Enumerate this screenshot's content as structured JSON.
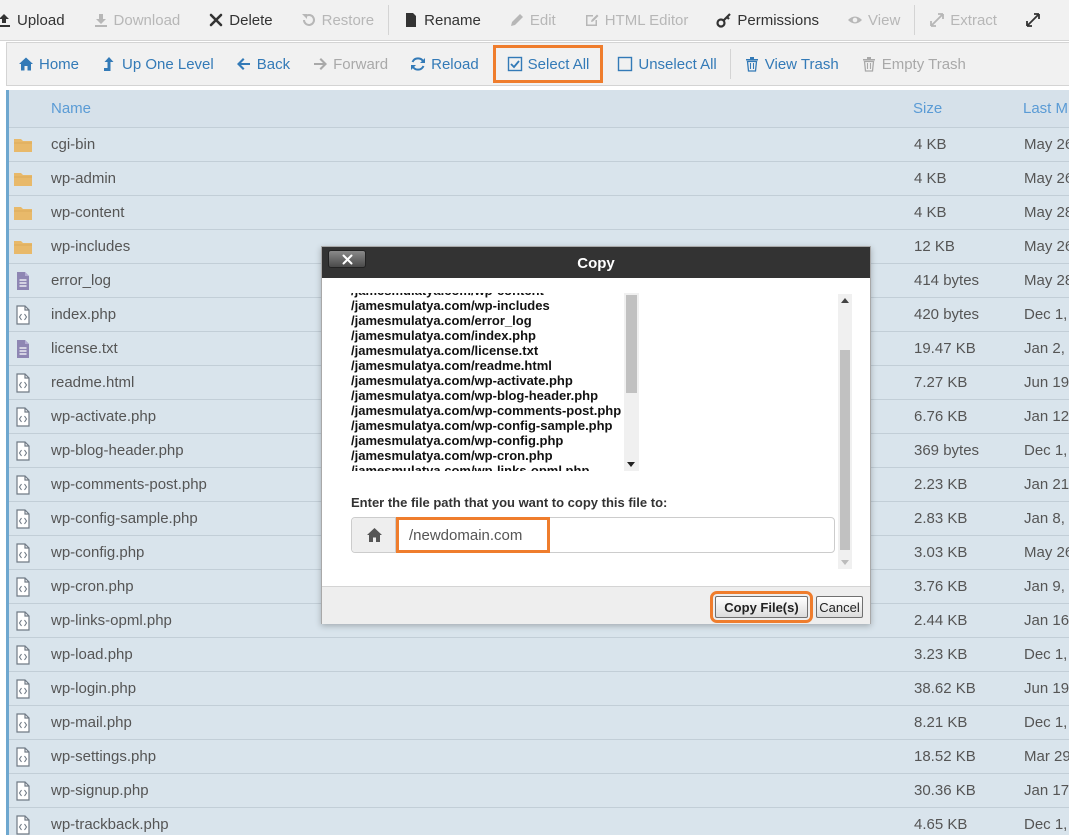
{
  "toolbar_top": [
    {
      "label": "Upload",
      "icon": "upload-icon",
      "disabled": false
    },
    {
      "label": "Download",
      "icon": "download-icon",
      "disabled": true
    },
    {
      "label": "Delete",
      "icon": "close-icon",
      "disabled": false
    },
    {
      "label": "Restore",
      "icon": "restore-icon",
      "disabled": true
    },
    {
      "label": "Rename",
      "icon": "file-icon",
      "disabled": false
    },
    {
      "label": "Edit",
      "icon": "pencil-icon",
      "disabled": true
    },
    {
      "label": "HTML Editor",
      "icon": "edit-square-icon",
      "disabled": true
    },
    {
      "label": "Permissions",
      "icon": "key-icon",
      "disabled": false
    },
    {
      "label": "View",
      "icon": "eye-icon",
      "disabled": true
    },
    {
      "label": "Extract",
      "icon": "expand-icon",
      "disabled": true
    }
  ],
  "toolbar_nav": [
    {
      "label": "Home",
      "icon": "home-icon",
      "disabled": false
    },
    {
      "label": "Up One Level",
      "icon": "level-up-icon",
      "disabled": false
    },
    {
      "label": "Back",
      "icon": "arrow-left-icon",
      "disabled": false
    },
    {
      "label": "Forward",
      "icon": "arrow-right-icon",
      "disabled": true
    },
    {
      "label": "Reload",
      "icon": "refresh-icon",
      "disabled": false
    },
    {
      "label": "Select All",
      "icon": "checkbox-checked-icon",
      "disabled": false,
      "highlighted": true
    },
    {
      "label": "Unselect All",
      "icon": "checkbox-empty-icon",
      "disabled": false
    },
    {
      "label": "View Trash",
      "icon": "trash-icon",
      "disabled": false
    },
    {
      "label": "Empty Trash",
      "icon": "trash-icon",
      "disabled": true
    }
  ],
  "table": {
    "columns": [
      "Name",
      "Size",
      "Last M"
    ],
    "rows": [
      {
        "name": "cgi-bin",
        "type": "folder",
        "size": "4 KB",
        "modified": "May 26"
      },
      {
        "name": "wp-admin",
        "type": "folder",
        "size": "4 KB",
        "modified": "May 26"
      },
      {
        "name": "wp-content",
        "type": "folder",
        "size": "4 KB",
        "modified": "May 28"
      },
      {
        "name": "wp-includes",
        "type": "folder",
        "size": "12 KB",
        "modified": "May 26"
      },
      {
        "name": "error_log",
        "type": "text",
        "size": "414 bytes",
        "modified": "May 28"
      },
      {
        "name": "index.php",
        "type": "code",
        "size": "420 bytes",
        "modified": "Dec 1,"
      },
      {
        "name": "license.txt",
        "type": "text",
        "size": "19.47 KB",
        "modified": "Jan 2,"
      },
      {
        "name": "readme.html",
        "type": "code",
        "size": "7.27 KB",
        "modified": "Jun 19"
      },
      {
        "name": "wp-activate.php",
        "type": "code",
        "size": "6.76 KB",
        "modified": "Jan 12"
      },
      {
        "name": "wp-blog-header.php",
        "type": "code",
        "size": "369 bytes",
        "modified": "Dec 1,"
      },
      {
        "name": "wp-comments-post.php",
        "type": "code",
        "size": "2.23 KB",
        "modified": "Jan 21"
      },
      {
        "name": "wp-config-sample.php",
        "type": "code",
        "size": "2.83 KB",
        "modified": "Jan 8,"
      },
      {
        "name": "wp-config.php",
        "type": "code",
        "size": "3.03 KB",
        "modified": "May 26"
      },
      {
        "name": "wp-cron.php",
        "type": "code",
        "size": "3.76 KB",
        "modified": "Jan 9,"
      },
      {
        "name": "wp-links-opml.php",
        "type": "code",
        "size": "2.44 KB",
        "modified": "Jan 16"
      },
      {
        "name": "wp-load.php",
        "type": "code",
        "size": "3.23 KB",
        "modified": "Dec 1,"
      },
      {
        "name": "wp-login.php",
        "type": "code",
        "size": "38.62 KB",
        "modified": "Jun 19"
      },
      {
        "name": "wp-mail.php",
        "type": "code",
        "size": "8.21 KB",
        "modified": "Dec 1,"
      },
      {
        "name": "wp-settings.php",
        "type": "code",
        "size": "18.52 KB",
        "modified": "Mar 29"
      },
      {
        "name": "wp-signup.php",
        "type": "code",
        "size": "30.36 KB",
        "modified": "Jan 17"
      },
      {
        "name": "wp-trackback.php",
        "type": "code",
        "size": "4.65 KB",
        "modified": "Dec 1,"
      }
    ]
  },
  "dialog": {
    "title": "Copy",
    "close_label": "×",
    "paths": [
      "/jamesmulatya.com/wp-content",
      "/jamesmulatya.com/wp-includes",
      "/jamesmulatya.com/error_log",
      "/jamesmulatya.com/index.php",
      "/jamesmulatya.com/license.txt",
      "/jamesmulatya.com/readme.html",
      "/jamesmulatya.com/wp-activate.php",
      "/jamesmulatya.com/wp-blog-header.php",
      "/jamesmulatya.com/wp-comments-post.php",
      "/jamesmulatya.com/wp-config-sample.php",
      "/jamesmulatya.com/wp-config.php",
      "/jamesmulatya.com/wp-cron.php",
      "/jamesmulatya.com/wp-links-opml.php"
    ],
    "prompt": "Enter the file path that you want to copy this file to:",
    "path_value": "/newdomain.com",
    "copy_button": "Copy File(s)",
    "cancel_button": "Cancel"
  },
  "colors": {
    "accent": "#337ab7",
    "highlight": "#ef7d2d",
    "table_bg": "#d9e4ec",
    "folder": "#e8b96a",
    "dialog_header": "#333333"
  }
}
